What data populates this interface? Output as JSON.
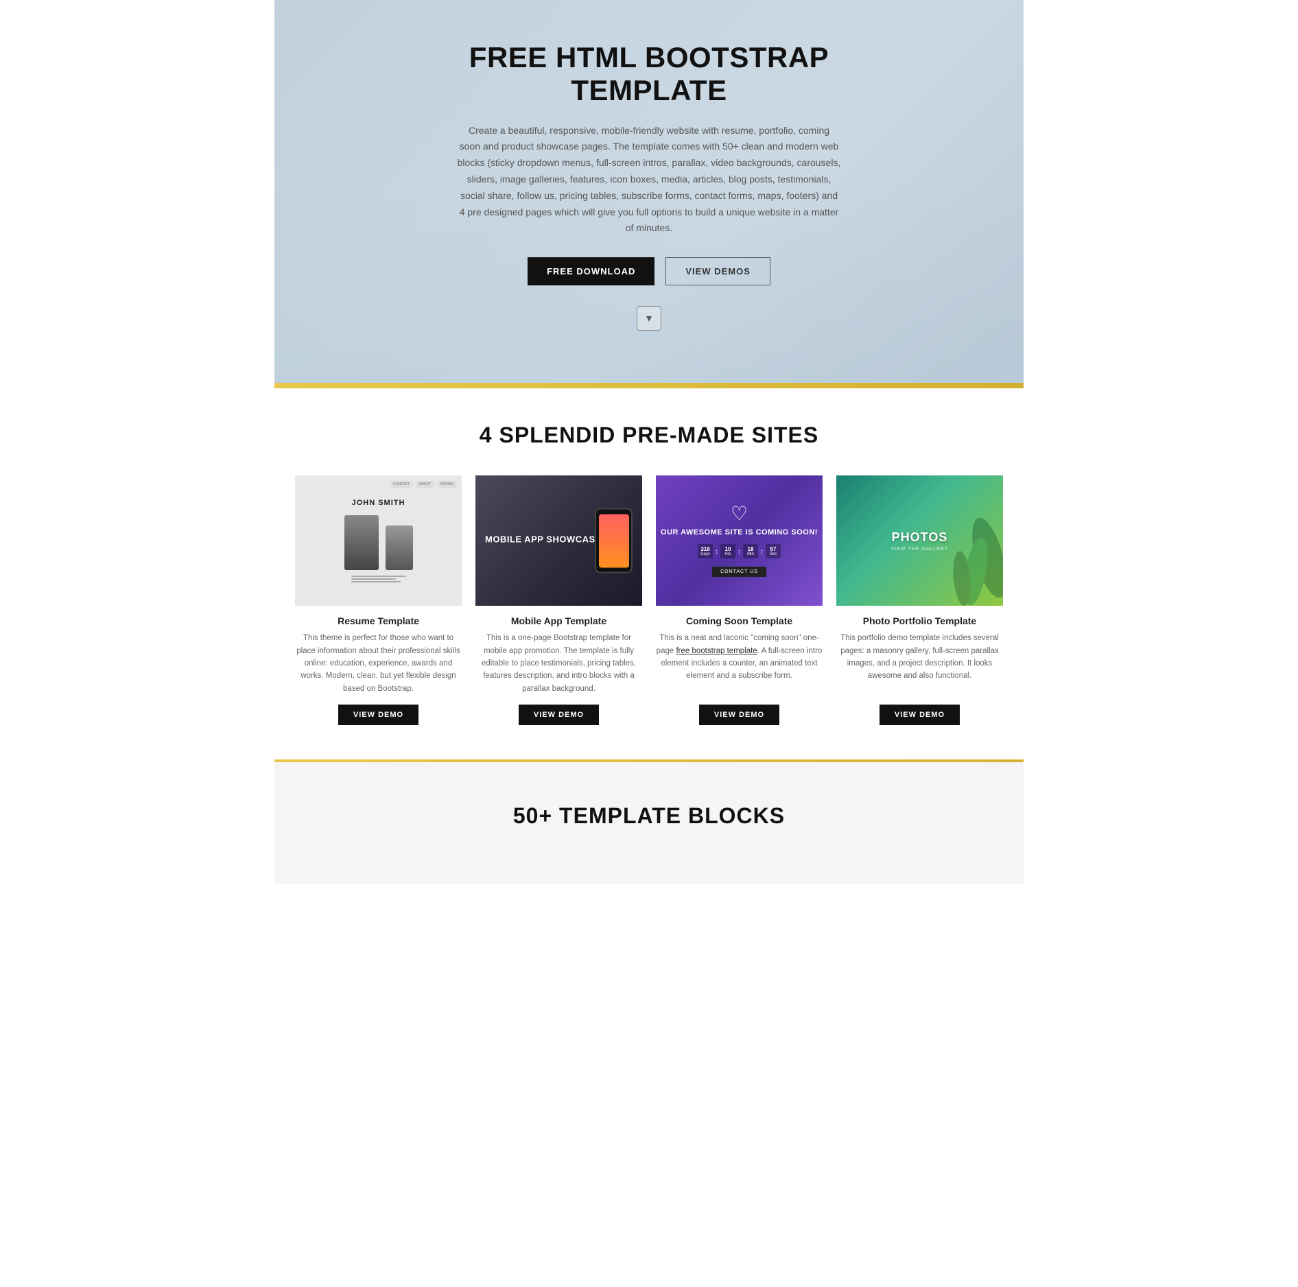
{
  "hero": {
    "title": "FREE HTML BOOTSTRAP TEMPLATE",
    "description": "Create a beautiful, responsive, mobile-friendly website with resume, portfolio, coming soon and product showcase pages. The template comes with 50+ clean and modern web blocks (sticky dropdown menus, full-screen intros, parallax, video backgrounds, carousels, sliders, image galleries, features, icon boxes, media, articles, blog posts, testimonials, social share, follow us, pricing tables, subscribe forms, contact forms, maps, footers) and 4 pre designed pages which will give you full options to build a unique website in a matter of minutes.",
    "btn_download": "FREE DOWNLOAD",
    "btn_demos": "VIEW DEMOS",
    "scroll_icon": "▾"
  },
  "premade": {
    "section_title": "4 SPLENDID PRE-MADE SITES",
    "cards": [
      {
        "id": "resume",
        "name": "Resume Template",
        "description": "This theme is perfect for those who want to place information about their professional skills online: education, experience, awards and works. Modern, clean, but yet flexible design based on Bootstrap.",
        "btn_label": "VIEW DEMO",
        "thumb_name": "JOHN SMITH"
      },
      {
        "id": "mobile",
        "name": "Mobile App Template",
        "description": "This is a one-page Bootstrap template for mobile app promotion. The template is fully editable to place testimonials, pricing tables, features description, and intro blocks with a parallax background.",
        "btn_label": "VIEW DEMO",
        "thumb_text": "MOBILE APP SHOWCASE"
      },
      {
        "id": "coming-soon",
        "name": "Coming Soon Template",
        "description": "This is a neat and laconic \"coming soon\" one-page free bootstrap template. A full-screen intro element includes a counter, an animated text element and a subscribe form.",
        "btn_label": "VIEW DEMO",
        "thumb_main": "OUR AWESOME SITE IS COMING SOON!",
        "thumb_counter": [
          "318",
          "10",
          "18",
          "57"
        ],
        "thumb_counter_labels": [
          "Days",
          "Hrs",
          "Min",
          "Sec"
        ]
      },
      {
        "id": "portfolio",
        "name": "Photo Portfolio Template",
        "description": "This portfolio demo template includes several pages: a masonry gallery, full-screen parallax images, and a project description. It looks awesome and also functional.",
        "btn_label": "VIEW DEMO",
        "thumb_title": "PHOTOS",
        "thumb_subtitle": "VIEW THE GALLERY"
      }
    ]
  },
  "blocks": {
    "section_title": "50+ TEMPLATE BLOCKS"
  }
}
